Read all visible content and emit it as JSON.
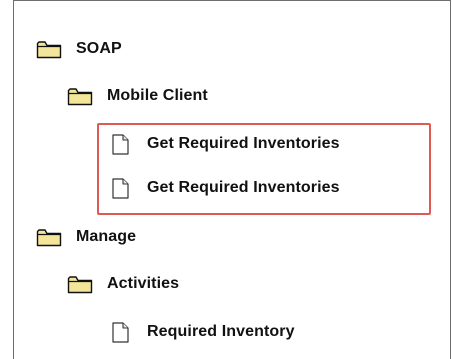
{
  "tree": {
    "items": [
      {
        "label": "SOAP",
        "icon": "folder-icon",
        "level": 0
      },
      {
        "label": "Mobile Client",
        "icon": "folder-icon",
        "level": 1
      },
      {
        "label": "Get Required Inventories",
        "icon": "document-icon",
        "level": 2
      },
      {
        "label": "Get Required Inventories",
        "icon": "document-icon",
        "level": 2
      },
      {
        "label": "Manage",
        "icon": "folder-icon",
        "level": 0
      },
      {
        "label": "Activities",
        "icon": "folder-icon",
        "level": 1
      },
      {
        "label": "Required Inventory",
        "icon": "document-icon",
        "level": 2
      }
    ]
  },
  "colors": {
    "highlight_border": "#e05a55",
    "folder_fill": "#f3e59a",
    "folder_stroke": "#111111",
    "panel_border": "#6e6e6e"
  }
}
